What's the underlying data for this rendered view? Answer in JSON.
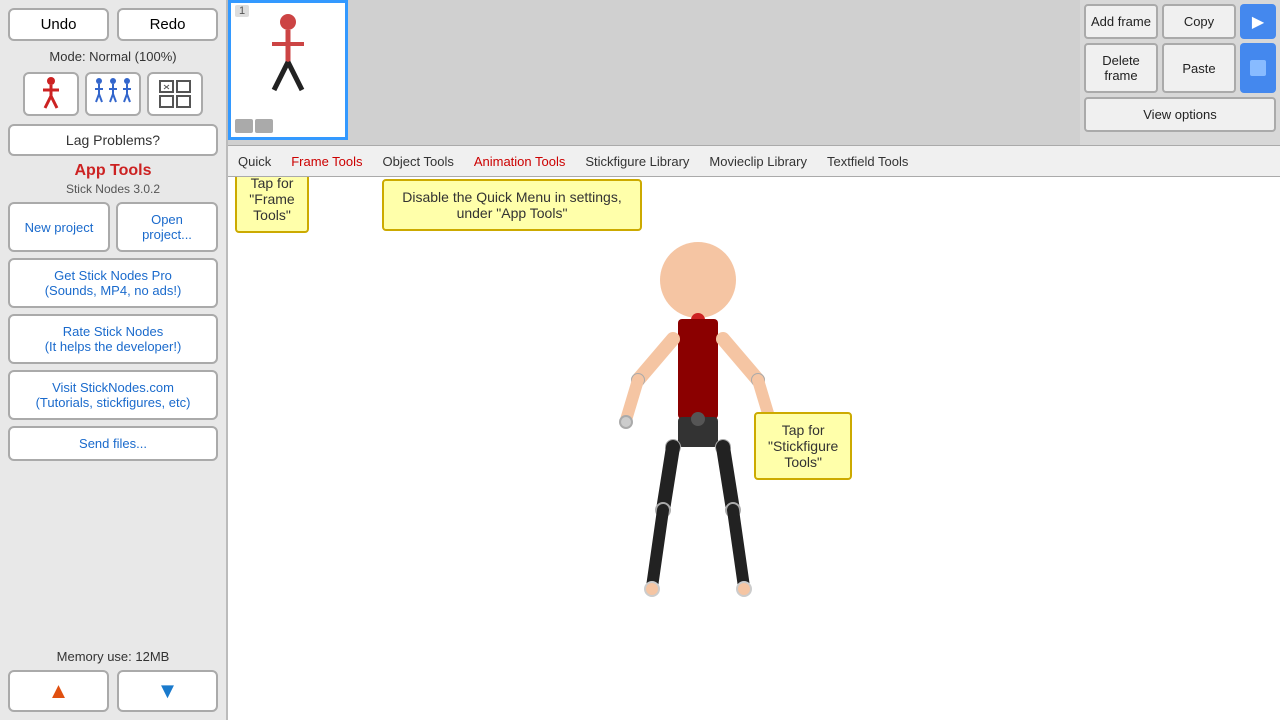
{
  "sidebar": {
    "undo_label": "Undo",
    "redo_label": "Redo",
    "mode_text": "Mode: Normal (100%)",
    "lag_btn": "Lag Problems?",
    "app_tools_title": "App Tools",
    "version": "Stick Nodes 3.0.2",
    "new_project": "New project",
    "open_project": "Open project...",
    "get_pro": "Get Stick Nodes Pro\n(Sounds, MP4, no ads!)",
    "rate": "Rate Stick Nodes\n(It helps the developer!)",
    "visit": "Visit StickNodes.com\n(Tutorials, stickfigures, etc)",
    "send_files": "Send files...",
    "memory": "Memory use: 12MB"
  },
  "topright": {
    "add_frame": "Add frame",
    "copy": "Copy",
    "delete_frame": "Delete frame",
    "paste": "Paste",
    "view_options": "View options"
  },
  "tabs": [
    {
      "label": "Quick",
      "active": false
    },
    {
      "label": "Frame Tools",
      "active": false
    },
    {
      "label": "Object Tools",
      "active": false
    },
    {
      "label": "Animation Tools",
      "active": false
    },
    {
      "label": "Stickfigure Library",
      "active": false
    },
    {
      "label": "Movieclip Library",
      "active": false
    },
    {
      "label": "Textfield Tools",
      "active": false
    }
  ],
  "tooltips": {
    "frame_tools": "Tap for \"Frame Tools\"",
    "quick_menu": "Disable the Quick Menu in settings, under \"App Tools\"",
    "stickfigure_tools": "Tap for \"Stickfigure Tools\""
  },
  "frame": {
    "number": "1"
  },
  "colors": {
    "accent_blue": "#3399ff",
    "accent_red": "#cc2222",
    "tooltip_bg": "#ffffaa",
    "tooltip_border": "#ccaa00"
  }
}
